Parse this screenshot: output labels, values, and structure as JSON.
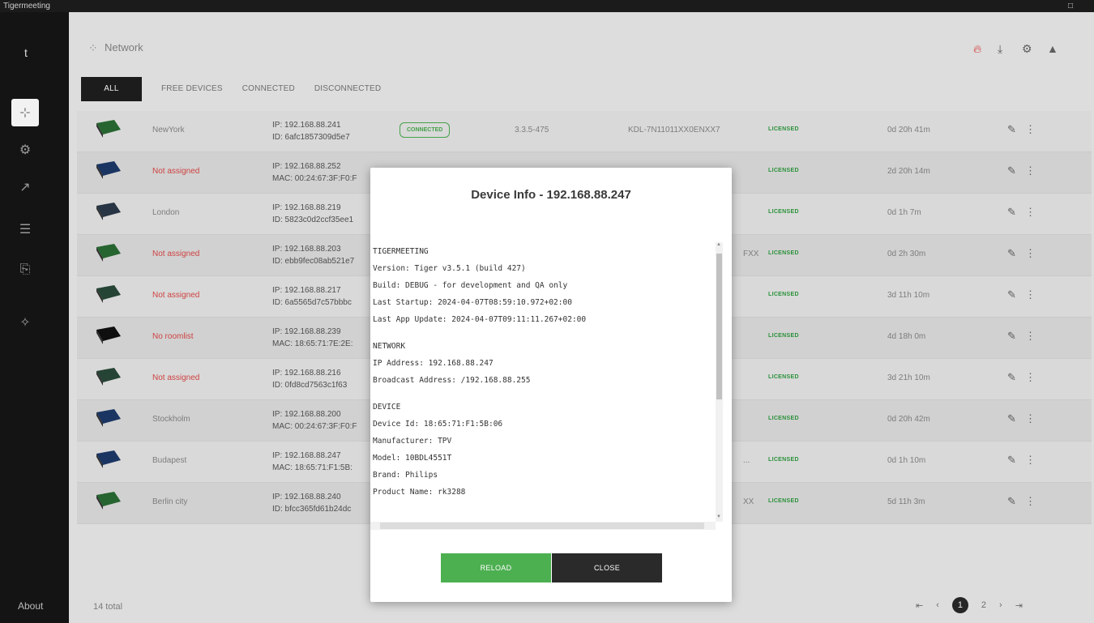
{
  "window": {
    "title": "Tigermeeting"
  },
  "header": {
    "title": "Network"
  },
  "tabs": [
    "ALL",
    "FREE DEVICES",
    "CONNECTED",
    "DISCONNECTED"
  ],
  "sidebar": {
    "logo": "t",
    "about": "About"
  },
  "rows": [
    {
      "name": "NewYork",
      "ip": "IP: 192.168.88.241",
      "id": "ID: 6afc1857309d5e7",
      "status": "CONNECTED",
      "version": "3.3.5-475",
      "serial": "KDL-7N11011XX0ENXX7",
      "license": "LICENSED",
      "uptime": "0d 20h 41m",
      "red": false
    },
    {
      "name": "Not assigned",
      "ip": "IP: 192.168.88.252",
      "id": "MAC: 00:24:67:3F:F0:F",
      "status": "",
      "version": "",
      "serial": "",
      "license": "LICENSED",
      "uptime": "2d 20h 14m",
      "red": true
    },
    {
      "name": "London",
      "ip": "IP: 192.168.88.219",
      "id": "ID: 5823c0d2ccf35ee1",
      "status": "",
      "version": "",
      "serial": "",
      "license": "LICENSED",
      "uptime": "0d 1h 7m",
      "red": false
    },
    {
      "name": "Not assigned",
      "ip": "IP: 192.168.88.203",
      "id": "ID: ebb9fec08ab521e7",
      "status": "",
      "version": "",
      "serial": "FXX",
      "license": "LICENSED",
      "uptime": "0d 2h 30m",
      "red": true
    },
    {
      "name": "Not assigned",
      "ip": "IP: 192.168.88.217",
      "id": "ID: 6a5565d7c57bbbc",
      "status": "",
      "version": "",
      "serial": "",
      "license": "LICENSED",
      "uptime": "3d 11h 10m",
      "red": true
    },
    {
      "name": "No roomlist",
      "ip": "IP: 192.168.88.239",
      "id": "MAC: 18:65:71:7E:2E:",
      "status": "",
      "version": "",
      "serial": "",
      "license": "LICENSED",
      "uptime": "4d 18h 0m",
      "red": true
    },
    {
      "name": "Not assigned",
      "ip": "IP: 192.168.88.216",
      "id": "ID: 0fd8cd7563c1f63",
      "status": "",
      "version": "",
      "serial": "",
      "license": "LICENSED",
      "uptime": "3d 21h 10m",
      "red": true
    },
    {
      "name": "Stockholm",
      "ip": "IP: 192.168.88.200",
      "id": "MAC: 00:24:67:3F:F0:F",
      "status": "",
      "version": "",
      "serial": "",
      "license": "LICENSED",
      "uptime": "0d 20h 42m",
      "red": false
    },
    {
      "name": "Budapest",
      "ip": "IP: 192.168.88.247",
      "id": "MAC: 18:65:71:F1:5B:",
      "status": "",
      "version": "",
      "serial": "...",
      "license": "LICENSED",
      "uptime": "0d 1h 10m",
      "red": false
    },
    {
      "name": "Berlin city",
      "ip": "IP: 192.168.88.240",
      "id": "ID: bfcc365fd61b24dc",
      "status": "",
      "version": "",
      "serial": "XX",
      "license": "LICENSED",
      "uptime": "5d 11h 3m",
      "red": false
    }
  ],
  "footer": {
    "total": "14 total",
    "pages": [
      "1",
      "2"
    ]
  },
  "modal": {
    "title": "Device Info - 192.168.88.247",
    "lines": [
      "TIGERMEETING",
      "Version: Tiger v3.5.1 (build 427)",
      "Build: DEBUG - for development and QA only",
      "Last Startup: 2024-04-07T08:59:10.972+02:00",
      "Last App Update: 2024-04-07T09:11:11.267+02:00",
      "",
      "NETWORK",
      "IP Address: 192.168.88.247",
      "Broadcast Address: /192.168.88.255",
      "",
      "DEVICE",
      "Device Id: 18:65:71:F1:5B:06",
      "Manufacturer: TPV",
      "Model: 10BDL4551T",
      "Brand: Philips",
      "Product Name: rk3288"
    ],
    "reload": "RELOAD",
    "close": "CLOSE"
  },
  "colors": {
    "accent": "#4caf50",
    "sidebar": "#141414",
    "danger": "#e04848"
  }
}
